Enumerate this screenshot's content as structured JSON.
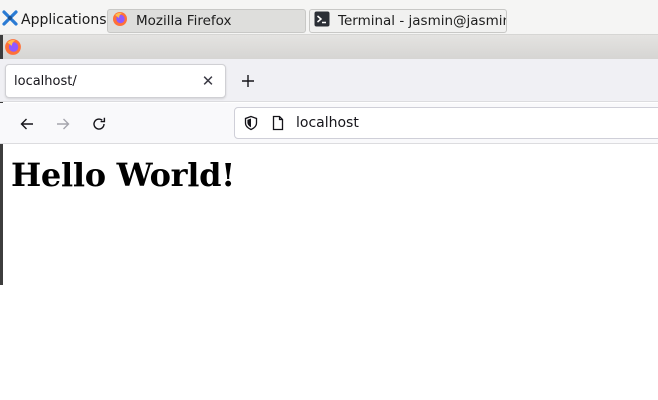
{
  "panel": {
    "applications_label": "Applications",
    "tasks": [
      {
        "label": "Mozilla Firefox",
        "icon": "firefox-icon",
        "active": true
      },
      {
        "label": "Terminal - jasmin@jasmin-...",
        "icon": "terminal-icon",
        "active": false
      }
    ]
  },
  "browser": {
    "tab_title": "localhost/",
    "url": "localhost"
  },
  "page": {
    "heading": "Hello World!"
  },
  "colors": {
    "firefox_orange": "#ff7139",
    "firefox_purple": "#9059ff",
    "xfce_blue": "#2a7bd4"
  }
}
